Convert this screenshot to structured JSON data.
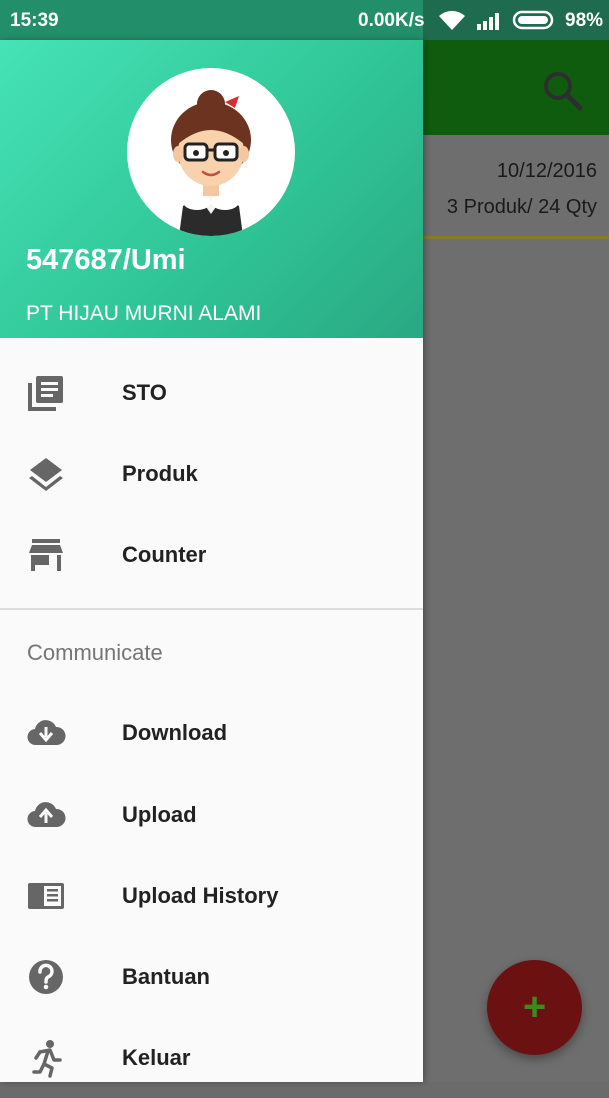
{
  "status_bar": {
    "time": "15:39",
    "network_speed": "0.00K/s",
    "battery": "98%"
  },
  "background": {
    "card": {
      "date": "10/12/2016",
      "summary": "3 Produk/ 24 Qty"
    },
    "fab_symbol": "+",
    "search_icon": "search-icon"
  },
  "drawer": {
    "header": {
      "user": "547687/Umi",
      "company": "PT HIJAU MURNI ALAMI"
    },
    "main_items": [
      {
        "label": "STO",
        "icon": "document-stack-icon"
      },
      {
        "label": "Produk",
        "icon": "layers-icon"
      },
      {
        "label": "Counter",
        "icon": "store-icon"
      }
    ],
    "section_title": "Communicate",
    "communicate_items": [
      {
        "label": "Download",
        "icon": "cloud-download-icon"
      },
      {
        "label": "Upload",
        "icon": "cloud-upload-icon"
      },
      {
        "label": "Upload History",
        "icon": "history-book-icon"
      },
      {
        "label": "Bantuan",
        "icon": "help-icon"
      },
      {
        "label": "Keluar",
        "icon": "exit-run-icon"
      }
    ]
  },
  "colors": {
    "header_gradient_start": "#45e3b7",
    "header_gradient_end": "#2aa883",
    "status_bar": "#238f6a",
    "toolbar_dimmed": "#0f5c0f",
    "fab_dimmed": "#6b1111",
    "icon_grey": "#666666"
  }
}
